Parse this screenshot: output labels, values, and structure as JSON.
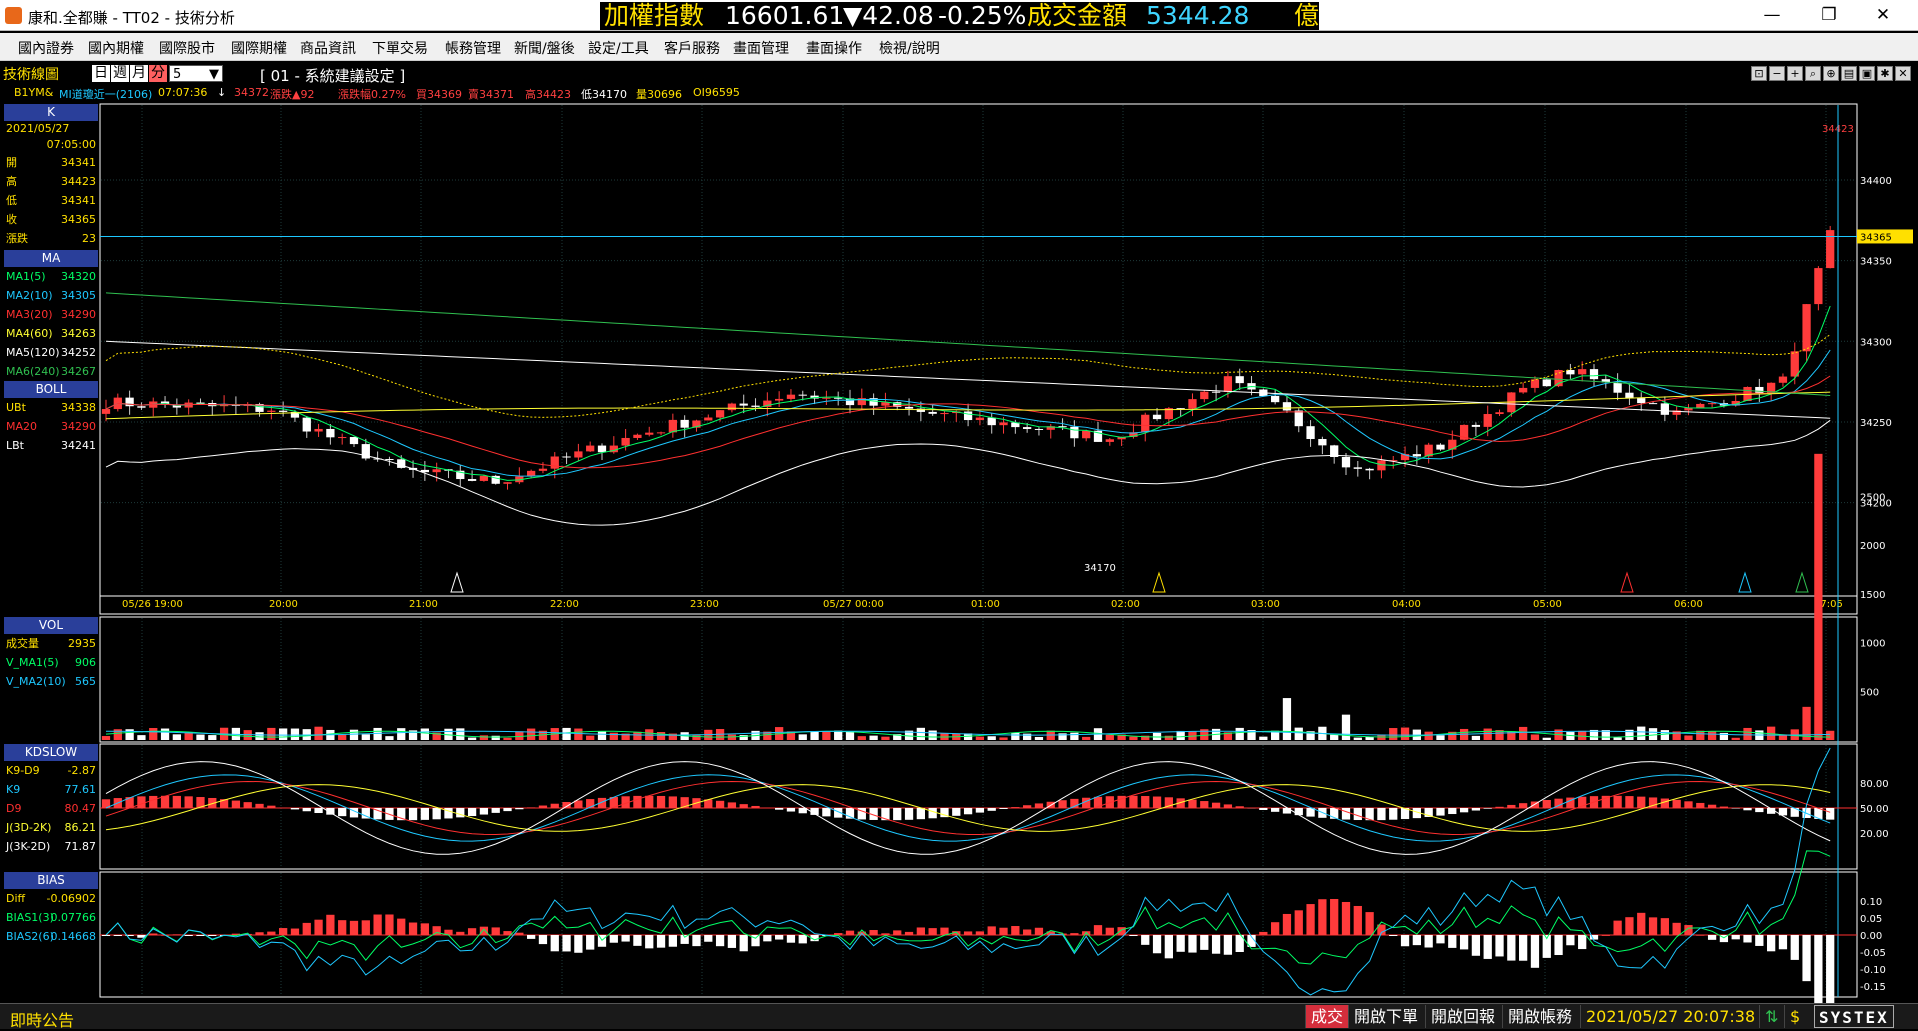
{
  "window": {
    "title": "康和.全都賺 - TT02 - 技術分析",
    "controls": {
      "minimize": "—",
      "maximize": "❐",
      "close": "✕"
    }
  },
  "ticker": {
    "label": "加權指數",
    "value": "16601.61",
    "change": "▼42.08",
    "pct": "-0.25%",
    "amount_label": "成交金額",
    "amount": "5344.28",
    "unit": "億"
  },
  "menu": [
    "國內證券",
    "國內期權",
    "國際股市",
    "國際期權",
    "商品資訊",
    "下單交易",
    "帳務管理",
    "新聞/盤後",
    "設定/工具",
    "客戶服務",
    "畫面管理",
    "畫面操作",
    "檢視/說明"
  ],
  "toolbar": {
    "label": "技術線圖",
    "periods": [
      "日",
      "週",
      "月",
      "分"
    ],
    "active_period": "分",
    "interval": "5",
    "setting": "[ 01 - 系統建議設定 ]"
  },
  "quote": {
    "symbol": "B1YM&",
    "name": "MI道瓊近一(2106)",
    "time": "07:07:36",
    "arrow": "↓",
    "last": "34372",
    "change": "漲跌▲92",
    "pct": "漲跌幅0.27%",
    "bid": "買34369",
    "ask": "賣34371",
    "high": "高34423",
    "low": "低34170",
    "volume": "量30696",
    "oi": "OI96595"
  },
  "panel_k": {
    "title": "K",
    "date": "2021/05/27",
    "time": "07:05:00",
    "rows": [
      {
        "name": "開",
        "value": "34341"
      },
      {
        "name": "高",
        "value": "34423"
      },
      {
        "name": "低",
        "value": "34341"
      },
      {
        "name": "收",
        "value": "34365"
      },
      {
        "name": "漲跌",
        "value": "23"
      }
    ]
  },
  "panel_ma": {
    "title": "MA",
    "rows": [
      {
        "name": "MA1(5)",
        "value": "34320"
      },
      {
        "name": "MA2(10)",
        "value": "34305"
      },
      {
        "name": "MA3(20)",
        "value": "34290"
      },
      {
        "name": "MA4(60)",
        "value": "34263"
      },
      {
        "name": "MA5(120)",
        "value": "34252"
      },
      {
        "name": "MA6(240)",
        "value": "34267"
      }
    ]
  },
  "panel_boll": {
    "title": "BOLL",
    "rows": [
      {
        "name": "UBt",
        "value": "34338"
      },
      {
        "name": "MA20",
        "value": "34290"
      },
      {
        "name": "LBt",
        "value": "34241"
      }
    ]
  },
  "panel_vol": {
    "title": "VOL",
    "rows": [
      {
        "name": "成交量",
        "value": "2935"
      },
      {
        "name": "V_MA1(5)",
        "value": "906"
      },
      {
        "name": "V_MA2(10)",
        "value": "565"
      }
    ]
  },
  "panel_kd": {
    "title": "KDSLOW",
    "rows": [
      {
        "name": "K9-D9",
        "value": "-2.87"
      },
      {
        "name": "K9",
        "value": "77.61"
      },
      {
        "name": "D9",
        "value": "80.47"
      },
      {
        "name": "J(3D-2K)",
        "value": "86.21"
      },
      {
        "name": "J(3K-2D)",
        "value": "71.87"
      }
    ]
  },
  "panel_bias": {
    "title": "BIAS",
    "rows": [
      {
        "name": "Diff",
        "value": "-0.06902"
      },
      {
        "name": "BIAS1(3)",
        "value": "0.07766"
      },
      {
        "name": "BIAS2(6)",
        "value": "0.14668"
      }
    ]
  },
  "colors": {
    "up": "#ff3b3b",
    "down": "#ffffff",
    "ma1": "#00ff66",
    "ma2": "#1ec8ff",
    "ma3": "#ff3030",
    "ma4": "#ffff33",
    "ma5": "#ffffff",
    "ma6": "#30c050",
    "label_yellow": "#ffe000"
  },
  "price_axis": [
    "34400",
    "34350",
    "34300",
    "34250",
    "34200"
  ],
  "current_price": "34365",
  "high_label": "34423",
  "low_label": "34170",
  "time_axis": [
    "05/26 19:00",
    "20:00",
    "21:00",
    "22:00",
    "23:00",
    "05/27 00:00",
    "01:00",
    "02:00",
    "03:00",
    "04:00",
    "05:00",
    "06:00",
    "07:05"
  ],
  "vol_axis": [
    "2500",
    "2000",
    "1500",
    "1000",
    "500"
  ],
  "kd_axis": [
    "80.00",
    "50.00",
    "20.00"
  ],
  "bias_axis": [
    "0.10",
    "0.05",
    "0.00",
    "-0.05",
    "-0.10",
    "-0.15"
  ],
  "statusbar": {
    "announce": "即時公告",
    "trade": "成交",
    "order": "開啟下單",
    "report": "開啟回報",
    "account": "開啟帳務",
    "datetime": "2021/05/27 20:07:38",
    "logo": "SYSTEX"
  }
}
